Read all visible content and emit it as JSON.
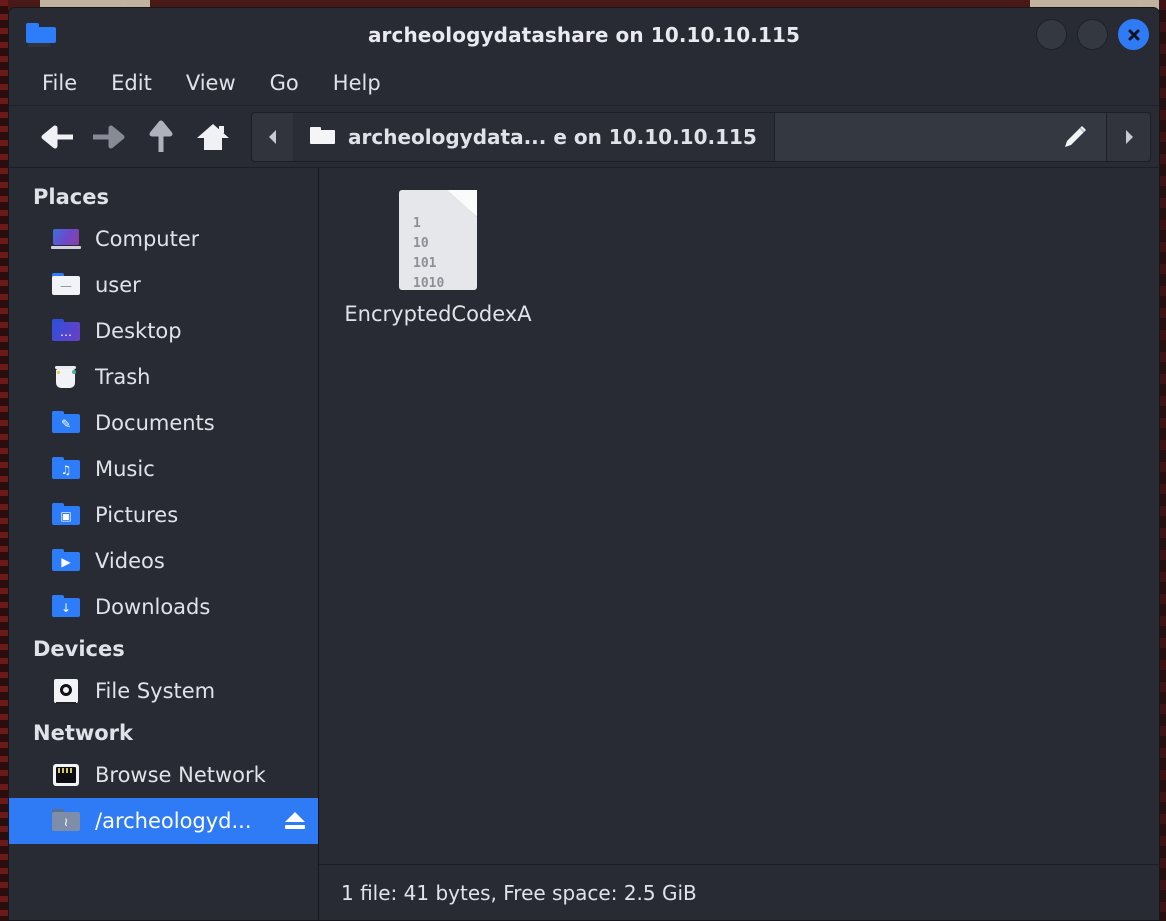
{
  "window": {
    "title": "archeologydatashare on 10.10.10.115",
    "folder_icon": "folder-icon",
    "controls": {
      "minimize_label": "",
      "maximize_label": "",
      "close_label": "✕"
    }
  },
  "menubar": {
    "items": [
      {
        "label": "File",
        "name": "menu-file"
      },
      {
        "label": "Edit",
        "name": "menu-edit"
      },
      {
        "label": "View",
        "name": "menu-view"
      },
      {
        "label": "Go",
        "name": "menu-go"
      },
      {
        "label": "Help",
        "name": "menu-help"
      }
    ]
  },
  "toolbar": {
    "back_icon": "back-arrow-icon",
    "forward_icon": "forward-arrow-icon",
    "up_icon": "up-arrow-icon",
    "home_icon": "home-icon",
    "path_scroll_left_icon": "chevron-left-icon",
    "path_crumb_label": "archeologydata... e on 10.10.10.115",
    "path_entry_value": "",
    "path_entry_placeholder": "",
    "edit_path_icon": "pencil-icon",
    "path_next_icon": "chevron-right-icon"
  },
  "sidebar": {
    "groups": [
      {
        "title": "Places",
        "name": "sidebar-group-places",
        "items": [
          {
            "label": "Computer",
            "icon": "computer-icon",
            "name": "sidebar-item-computer",
            "selected": false
          },
          {
            "label": "user",
            "icon": "home-folder-icon",
            "name": "sidebar-item-user",
            "selected": false
          },
          {
            "label": "Desktop",
            "icon": "desktop-folder-icon",
            "name": "sidebar-item-desktop",
            "selected": false
          },
          {
            "label": "Trash",
            "icon": "trash-icon",
            "name": "sidebar-item-trash",
            "selected": false
          },
          {
            "label": "Documents",
            "icon": "documents-folder-icon",
            "name": "sidebar-item-documents",
            "selected": false
          },
          {
            "label": "Music",
            "icon": "music-folder-icon",
            "name": "sidebar-item-music",
            "selected": false
          },
          {
            "label": "Pictures",
            "icon": "pictures-folder-icon",
            "name": "sidebar-item-pictures",
            "selected": false
          },
          {
            "label": "Videos",
            "icon": "videos-folder-icon",
            "name": "sidebar-item-videos",
            "selected": false
          },
          {
            "label": "Downloads",
            "icon": "downloads-folder-icon",
            "name": "sidebar-item-downloads",
            "selected": false
          }
        ]
      },
      {
        "title": "Devices",
        "name": "sidebar-group-devices",
        "items": [
          {
            "label": "File System",
            "icon": "drive-icon",
            "name": "sidebar-item-file-system",
            "selected": false
          }
        ]
      },
      {
        "title": "Network",
        "name": "sidebar-group-network",
        "items": [
          {
            "label": "Browse Network",
            "icon": "network-port-icon",
            "name": "sidebar-item-browse-network",
            "selected": false
          },
          {
            "label": "/archeologyd...",
            "icon": "network-share-folder-icon",
            "name": "sidebar-item-archeology-share",
            "selected": true,
            "eject": true
          }
        ]
      }
    ],
    "glyphs": {
      "documents": "✎",
      "music": "♫",
      "pictures": "▣",
      "videos": "▶",
      "downloads": "↓",
      "user": "—",
      "desktop": "…",
      "network_share": "≀"
    }
  },
  "main": {
    "files": [
      {
        "name": "EncryptedCodexA",
        "icon": "binary-file-icon",
        "icon_bits": "1\n10\n101\n1010"
      }
    ]
  },
  "statusbar": {
    "text": "1 file: 41 bytes, Free space: 2.5 GiB"
  },
  "colors": {
    "window_bg": "#282b33",
    "accent_blue": "#2f7bf6",
    "text": "#dfe2e9",
    "desktop_bg": "#3a1212"
  }
}
